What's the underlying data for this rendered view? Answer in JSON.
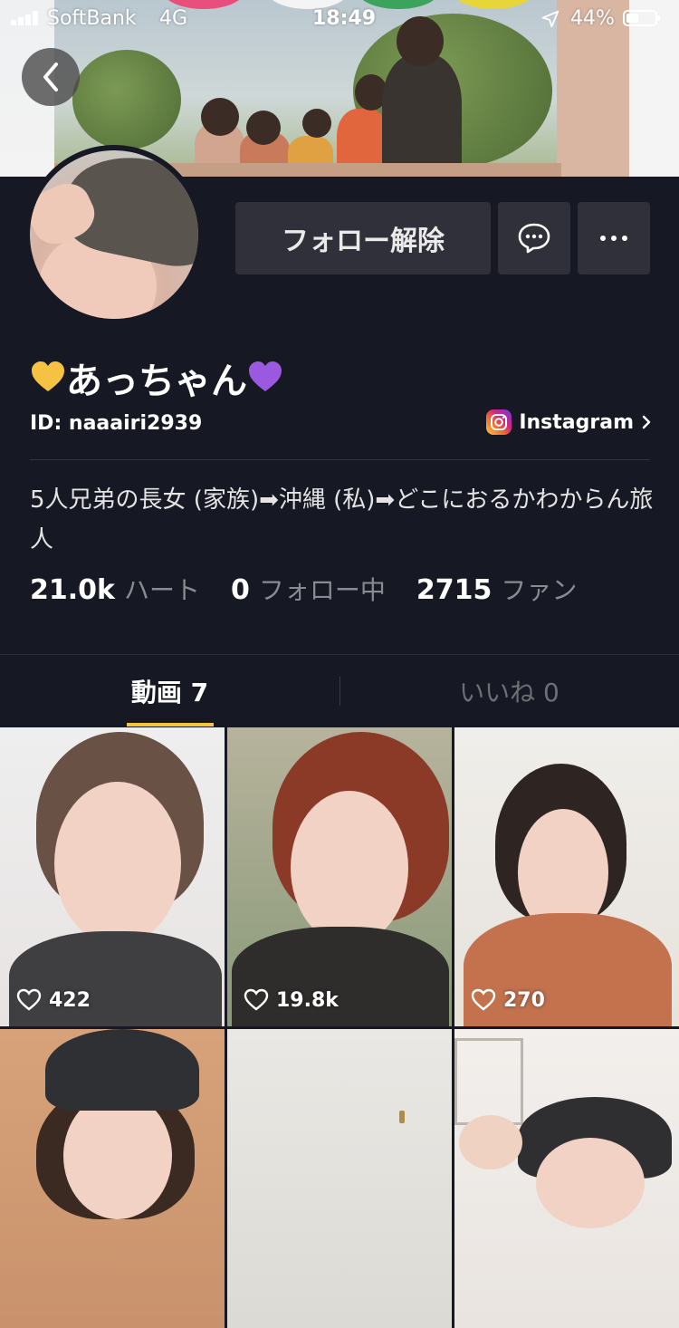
{
  "status_bar": {
    "carrier": "SoftBank",
    "network": "4G",
    "time": "18:49",
    "battery_percent": "44%",
    "battery_level": 0.44
  },
  "profile": {
    "display_name": "あっちゃん",
    "user_id": "ID: naaairi2939",
    "instagram_label": "Instagram",
    "bio": "5人兄弟の長女  (家族)➡沖縄 (私)➡どこにおるかわからん旅人"
  },
  "actions": {
    "unfollow_label": "フォロー解除"
  },
  "stats": {
    "hearts_value": "21.0k",
    "hearts_label": "ハート",
    "following_value": "0",
    "following_label": "フォロー中",
    "fans_value": "2715",
    "fans_label": "ファン"
  },
  "tabs": {
    "videos_label": "動画 7",
    "likes_label": "いいね 0"
  },
  "videos": [
    {
      "likes": "422"
    },
    {
      "likes": "19.8k"
    },
    {
      "likes": "270"
    },
    {
      "likes": ""
    },
    {
      "likes": ""
    },
    {
      "likes": ""
    }
  ],
  "colors": {
    "background": "#161823",
    "button": "#2f3039",
    "tab_indicator": "#f4c534",
    "muted_text": "#8a8b91"
  },
  "icons": {
    "back": "chevron-left-icon",
    "message": "message-bubble-icon",
    "more": "more-dots-icon",
    "instagram": "instagram-icon",
    "location": "location-arrow-icon",
    "heart_yellow": "yellow-heart-icon",
    "heart_purple": "purple-heart-icon",
    "like": "heart-outline-icon"
  }
}
